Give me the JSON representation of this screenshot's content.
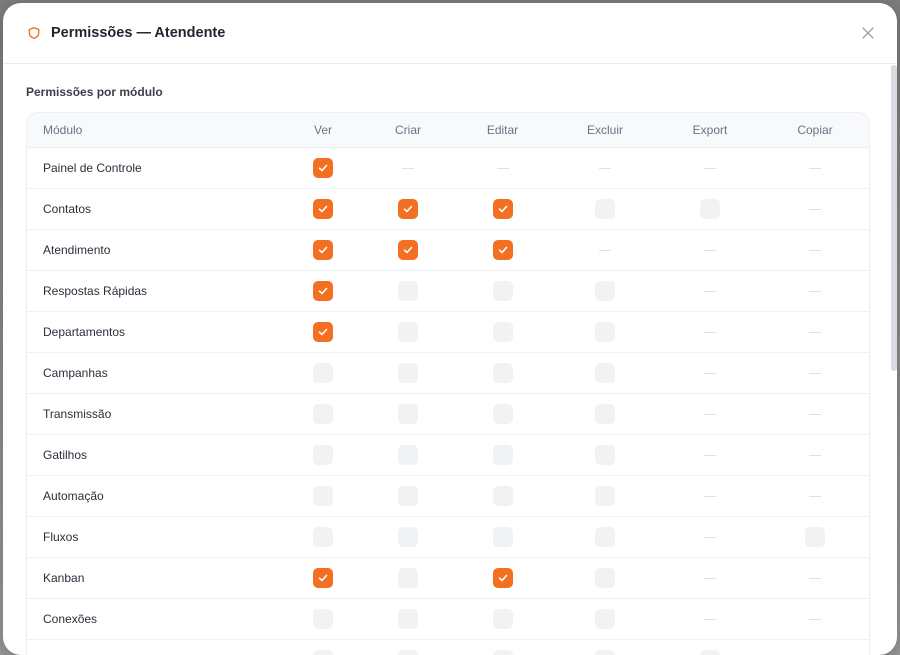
{
  "dialog": {
    "title": "Permissões — Atendente",
    "section_title": "Permissões por módulo"
  },
  "colors": {
    "accent": "#f36f21",
    "checkbox_off": "#f1f2f4"
  },
  "table": {
    "columns": [
      "Módulo",
      "Ver",
      "Criar",
      "Editar",
      "Excluir",
      "Export",
      "Copiar"
    ],
    "rows": [
      {
        "module": "Painel de Controle",
        "cells": [
          "on",
          "na",
          "na",
          "na",
          "na",
          "na"
        ]
      },
      {
        "module": "Contatos",
        "cells": [
          "on",
          "on",
          "on",
          "off",
          "off",
          "na"
        ]
      },
      {
        "module": "Atendimento",
        "cells": [
          "on",
          "on",
          "on",
          "na",
          "na",
          "na"
        ]
      },
      {
        "module": "Respostas Rápidas",
        "cells": [
          "on",
          "off",
          "off",
          "off",
          "na",
          "na"
        ]
      },
      {
        "module": "Departamentos",
        "cells": [
          "on",
          "off",
          "off",
          "off",
          "na",
          "na"
        ]
      },
      {
        "module": "Campanhas",
        "cells": [
          "off",
          "off",
          "off",
          "off",
          "na",
          "na"
        ]
      },
      {
        "module": "Transmissão",
        "cells": [
          "off",
          "off",
          "off",
          "off",
          "na",
          "na"
        ]
      },
      {
        "module": "Gatilhos",
        "cells": [
          "off",
          "off",
          "off",
          "off",
          "na",
          "na"
        ]
      },
      {
        "module": "Automação",
        "cells": [
          "off",
          "off",
          "off",
          "off",
          "na",
          "na"
        ]
      },
      {
        "module": "Fluxos",
        "cells": [
          "off",
          "off",
          "off",
          "off",
          "na",
          "off"
        ]
      },
      {
        "module": "Kanban",
        "cells": [
          "on",
          "off",
          "on",
          "off",
          "na",
          "na"
        ]
      },
      {
        "module": "Conexões",
        "cells": [
          "off",
          "off",
          "off",
          "off",
          "na",
          "na"
        ]
      },
      {
        "module": "",
        "cells": [
          "off",
          "off",
          "off",
          "off",
          "off",
          "na"
        ]
      }
    ]
  }
}
